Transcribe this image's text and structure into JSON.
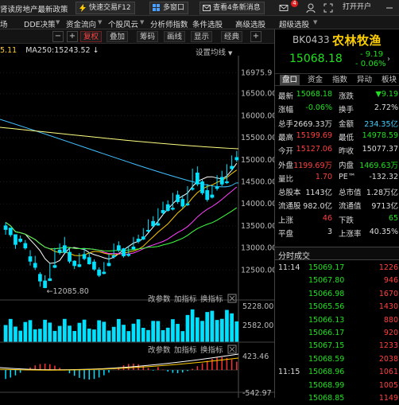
{
  "topbar": {
    "news": "肾读房地产最新政策",
    "quick_trade": "快速交易F12",
    "multi_window": "多窗口",
    "message": "查看4条新消息",
    "badge": "4",
    "open": "打开开户"
  },
  "menu": [
    "场",
    "DDE决策",
    "资金流向",
    "个股风云",
    "分析师指数",
    "条件选股",
    "高级选股",
    "超级选股"
  ],
  "toolbar": {
    "buttons": [
      "复权",
      "叠加",
      "筹码",
      "画线",
      "显示",
      "经典"
    ],
    "minus": "−",
    "plus": "+",
    "plus2": "+"
  },
  "ma": {
    "prefix": "5.11",
    "ma250": "MA250:15243.52"
  },
  "setma": "设置均线",
  "chart_data": {
    "type": "candlestick",
    "y_ticks": [
      "16975.9",
      "16500.00",
      "16000.00",
      "15500.00",
      "15000.00",
      "14500.00",
      "14000.00",
      "13500.00",
      "13000.00",
      "12500.00"
    ],
    "low_label": "12085.80",
    "low_value": 12085.8,
    "ylim": [
      12000,
      17000
    ],
    "candles": [
      [
        13500,
        13580,
        13420,
        13300
      ],
      [
        13450,
        13420,
        13300,
        13250
      ],
      [
        13300,
        13100,
        13080,
        12980
      ],
      [
        13200,
        13280,
        13150,
        13120
      ],
      [
        13100,
        13180,
        13000,
        12960
      ],
      [
        12800,
        12950,
        12700,
        12600
      ],
      [
        12650,
        12820,
        12560,
        12500
      ],
      [
        12400,
        12450,
        12250,
        12120
      ],
      [
        12250,
        12380,
        12100,
        12086
      ],
      [
        12300,
        12650,
        12260,
        12250
      ],
      [
        12600,
        13000,
        12560,
        12540
      ],
      [
        12950,
        13100,
        12900,
        12850
      ],
      [
        13050,
        13250,
        12900,
        12880
      ],
      [
        12900,
        12980,
        12700,
        12650
      ],
      [
        12700,
        12720,
        12600,
        12520
      ],
      [
        12620,
        12880,
        12580,
        12560
      ],
      [
        12850,
        13000,
        12760,
        12720
      ],
      [
        12780,
        12900,
        12640,
        12620
      ],
      [
        12680,
        12740,
        12520,
        12480
      ],
      [
        12500,
        12560,
        12380,
        12340
      ],
      [
        12450,
        12680,
        12420,
        12400
      ],
      [
        12650,
        12860,
        12600,
        12580
      ],
      [
        12820,
        13100,
        12800,
        12760
      ],
      [
        13050,
        13150,
        12950,
        12900
      ],
      [
        12980,
        13000,
        12820,
        12780
      ],
      [
        12850,
        13050,
        12830,
        12800
      ],
      [
        13020,
        13250,
        12980,
        12950
      ],
      [
        13200,
        13300,
        13150,
        13100
      ],
      [
        13250,
        13450,
        13200,
        13180
      ],
      [
        13400,
        13650,
        13380,
        13350
      ],
      [
        13600,
        13720,
        13500,
        13480
      ],
      [
        13550,
        13900,
        13520,
        13500
      ],
      [
        13850,
        14050,
        13800,
        13750
      ],
      [
        13980,
        14080,
        13850,
        13820
      ],
      [
        13900,
        14250,
        13880,
        13850
      ],
      [
        14200,
        14300,
        14050,
        14000
      ],
      [
        14100,
        14200,
        13950,
        13900
      ],
      [
        14000,
        14400,
        13980,
        13950
      ],
      [
        14350,
        14800,
        14330,
        14300
      ],
      [
        14700,
        14850,
        14450,
        14400
      ],
      [
        14500,
        14550,
        14250,
        14200
      ],
      [
        14300,
        14450,
        14100,
        14050
      ],
      [
        14200,
        14420,
        14150,
        14120
      ],
      [
        14380,
        14650,
        14350,
        14300
      ],
      [
        14600,
        14750,
        14450,
        14400
      ],
      [
        14500,
        14900,
        14480,
        14450
      ],
      [
        14850,
        15100,
        14800,
        14750
      ],
      [
        15050,
        15200,
        15000,
        14950
      ]
    ],
    "vol_ticks": [
      "5228.00",
      "2582.00"
    ],
    "indicator_ticks": [
      "423.46",
      "-542.97"
    ],
    "vol_labels": [
      "改参数",
      "加指标",
      "换指标"
    ],
    "ind_labels": [
      "改参数",
      "加指标",
      "换指标"
    ]
  },
  "quote": {
    "code": "BK0433",
    "name": "农林牧渔",
    "price": "15068.18",
    "change": "- 9.19",
    "pct": "- 0.06%",
    "tabs": [
      "盘口",
      "资金",
      "指数",
      "异动",
      "板块"
    ],
    "rows": [
      {
        "k1": "最新",
        "v1": "15068.18",
        "c1": "#20e020",
        "k2": "涨跌",
        "v2": "▼9.19",
        "c2": "#20e020"
      },
      {
        "k1": "涨幅",
        "v1": "-0.06%",
        "c1": "#20e020",
        "k2": "换手",
        "v2": "2.72%",
        "c2": "#ddd"
      },
      {
        "k1": "总手",
        "v1": "2669.33万",
        "c1": "#ddd",
        "k2": "金额",
        "v2": "234.35亿",
        "c2": "#40d0ff"
      },
      {
        "k1": "最高",
        "v1": "15199.69",
        "c1": "#ff4040",
        "k2": "最低",
        "v2": "14978.59",
        "c2": "#20e020"
      },
      {
        "k1": "今开",
        "v1": "15127.06",
        "c1": "#ff4040",
        "k2": "昨收",
        "v2": "15077.37",
        "c2": "#ddd"
      },
      {
        "k1": "外盘",
        "v1": "1199.69万",
        "c1": "#ff4040",
        "k2": "内盘",
        "v2": "1469.63万",
        "c2": "#20e020"
      },
      {
        "k1": "量比",
        "v1": "1.70",
        "c1": "#ff4040",
        "k2": "PE™",
        "v2": "-132.32",
        "c2": "#ddd"
      },
      {
        "k1": "总股本",
        "v1": "1143亿",
        "c1": "#ddd",
        "k2": "总市值",
        "v2": "1.28万亿",
        "c2": "#ddd"
      },
      {
        "k1": "流通股",
        "v1": "982.0亿",
        "c1": "#ddd",
        "k2": "流通值",
        "v2": "9713亿",
        "c2": "#ddd"
      },
      {
        "k1": "上涨",
        "v1": "46",
        "c1": "#ff4040",
        "k2": "下跌",
        "v2": "65",
        "c2": "#20e020"
      },
      {
        "k1": "平盘",
        "v1": "3",
        "c1": "#ddd",
        "k2": "上涨率",
        "v2": "40.35%",
        "c2": "#ddd"
      }
    ]
  },
  "trades": {
    "title": "分时成交",
    "rows": [
      {
        "t": "11:14",
        "p": "15069.17",
        "pc": "#20e020",
        "v": "1226",
        "vc": "#ff4040"
      },
      {
        "t": "",
        "p": "15067.80",
        "pc": "#20e020",
        "v": "946",
        "vc": "#ff4040"
      },
      {
        "t": "",
        "p": "15066.98",
        "pc": "#20e020",
        "v": "1670",
        "vc": "#ff4040"
      },
      {
        "t": "",
        "p": "15065.56",
        "pc": "#20e020",
        "v": "1430",
        "vc": "#ff4040"
      },
      {
        "t": "",
        "p": "15066.13",
        "pc": "#20e020",
        "v": "880",
        "vc": "#ff4040"
      },
      {
        "t": "",
        "p": "15066.17",
        "pc": "#20e020",
        "v": "920",
        "vc": "#ff4040"
      },
      {
        "t": "",
        "p": "15067.15",
        "pc": "#20e020",
        "v": "1233",
        "vc": "#ff4040"
      },
      {
        "t": "",
        "p": "15068.59",
        "pc": "#20e020",
        "v": "2038",
        "vc": "#ff4040"
      },
      {
        "t": "11:15",
        "p": "15068.96",
        "pc": "#20e020",
        "v": "1061",
        "vc": "#ff4040"
      },
      {
        "t": "",
        "p": "15068.99",
        "pc": "#20e020",
        "v": "1005",
        "vc": "#ff4040"
      },
      {
        "t": "",
        "p": "15068.85",
        "pc": "#20e020",
        "v": "1149",
        "vc": "#ff4040"
      }
    ]
  }
}
